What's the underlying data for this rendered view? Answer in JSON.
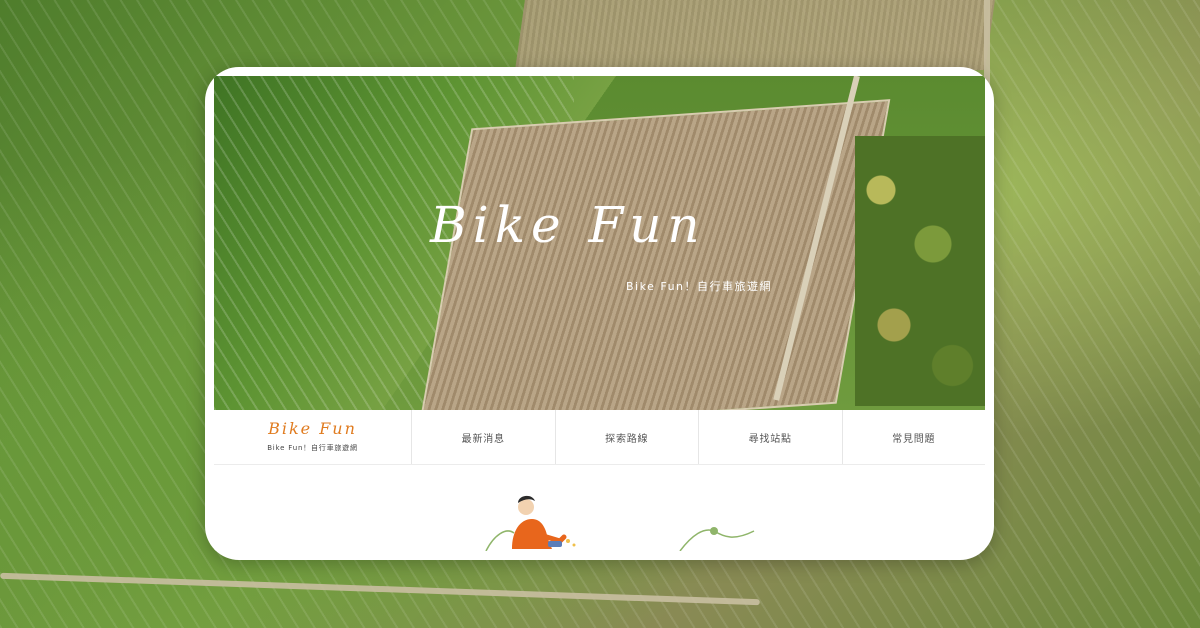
{
  "hero": {
    "logo_text": "Bike Fun",
    "tagline": "Bike Fun！自行車旅遊網"
  },
  "nav": {
    "brand_logo": "Bike Fun",
    "brand_sub": "Bike Fun！自行車旅遊網",
    "items": [
      {
        "label": "最新消息"
      },
      {
        "label": "探索路線"
      },
      {
        "label": "尋找站點"
      },
      {
        "label": "常見問題"
      }
    ]
  },
  "colors": {
    "brand_orange": "#e07b1f",
    "illustration_green": "#8fb56a",
    "jacket_orange": "#e8661c"
  },
  "icons": {
    "cyclist": "cyclist-illustration",
    "squiggle": "squiggle-line-decoration"
  }
}
